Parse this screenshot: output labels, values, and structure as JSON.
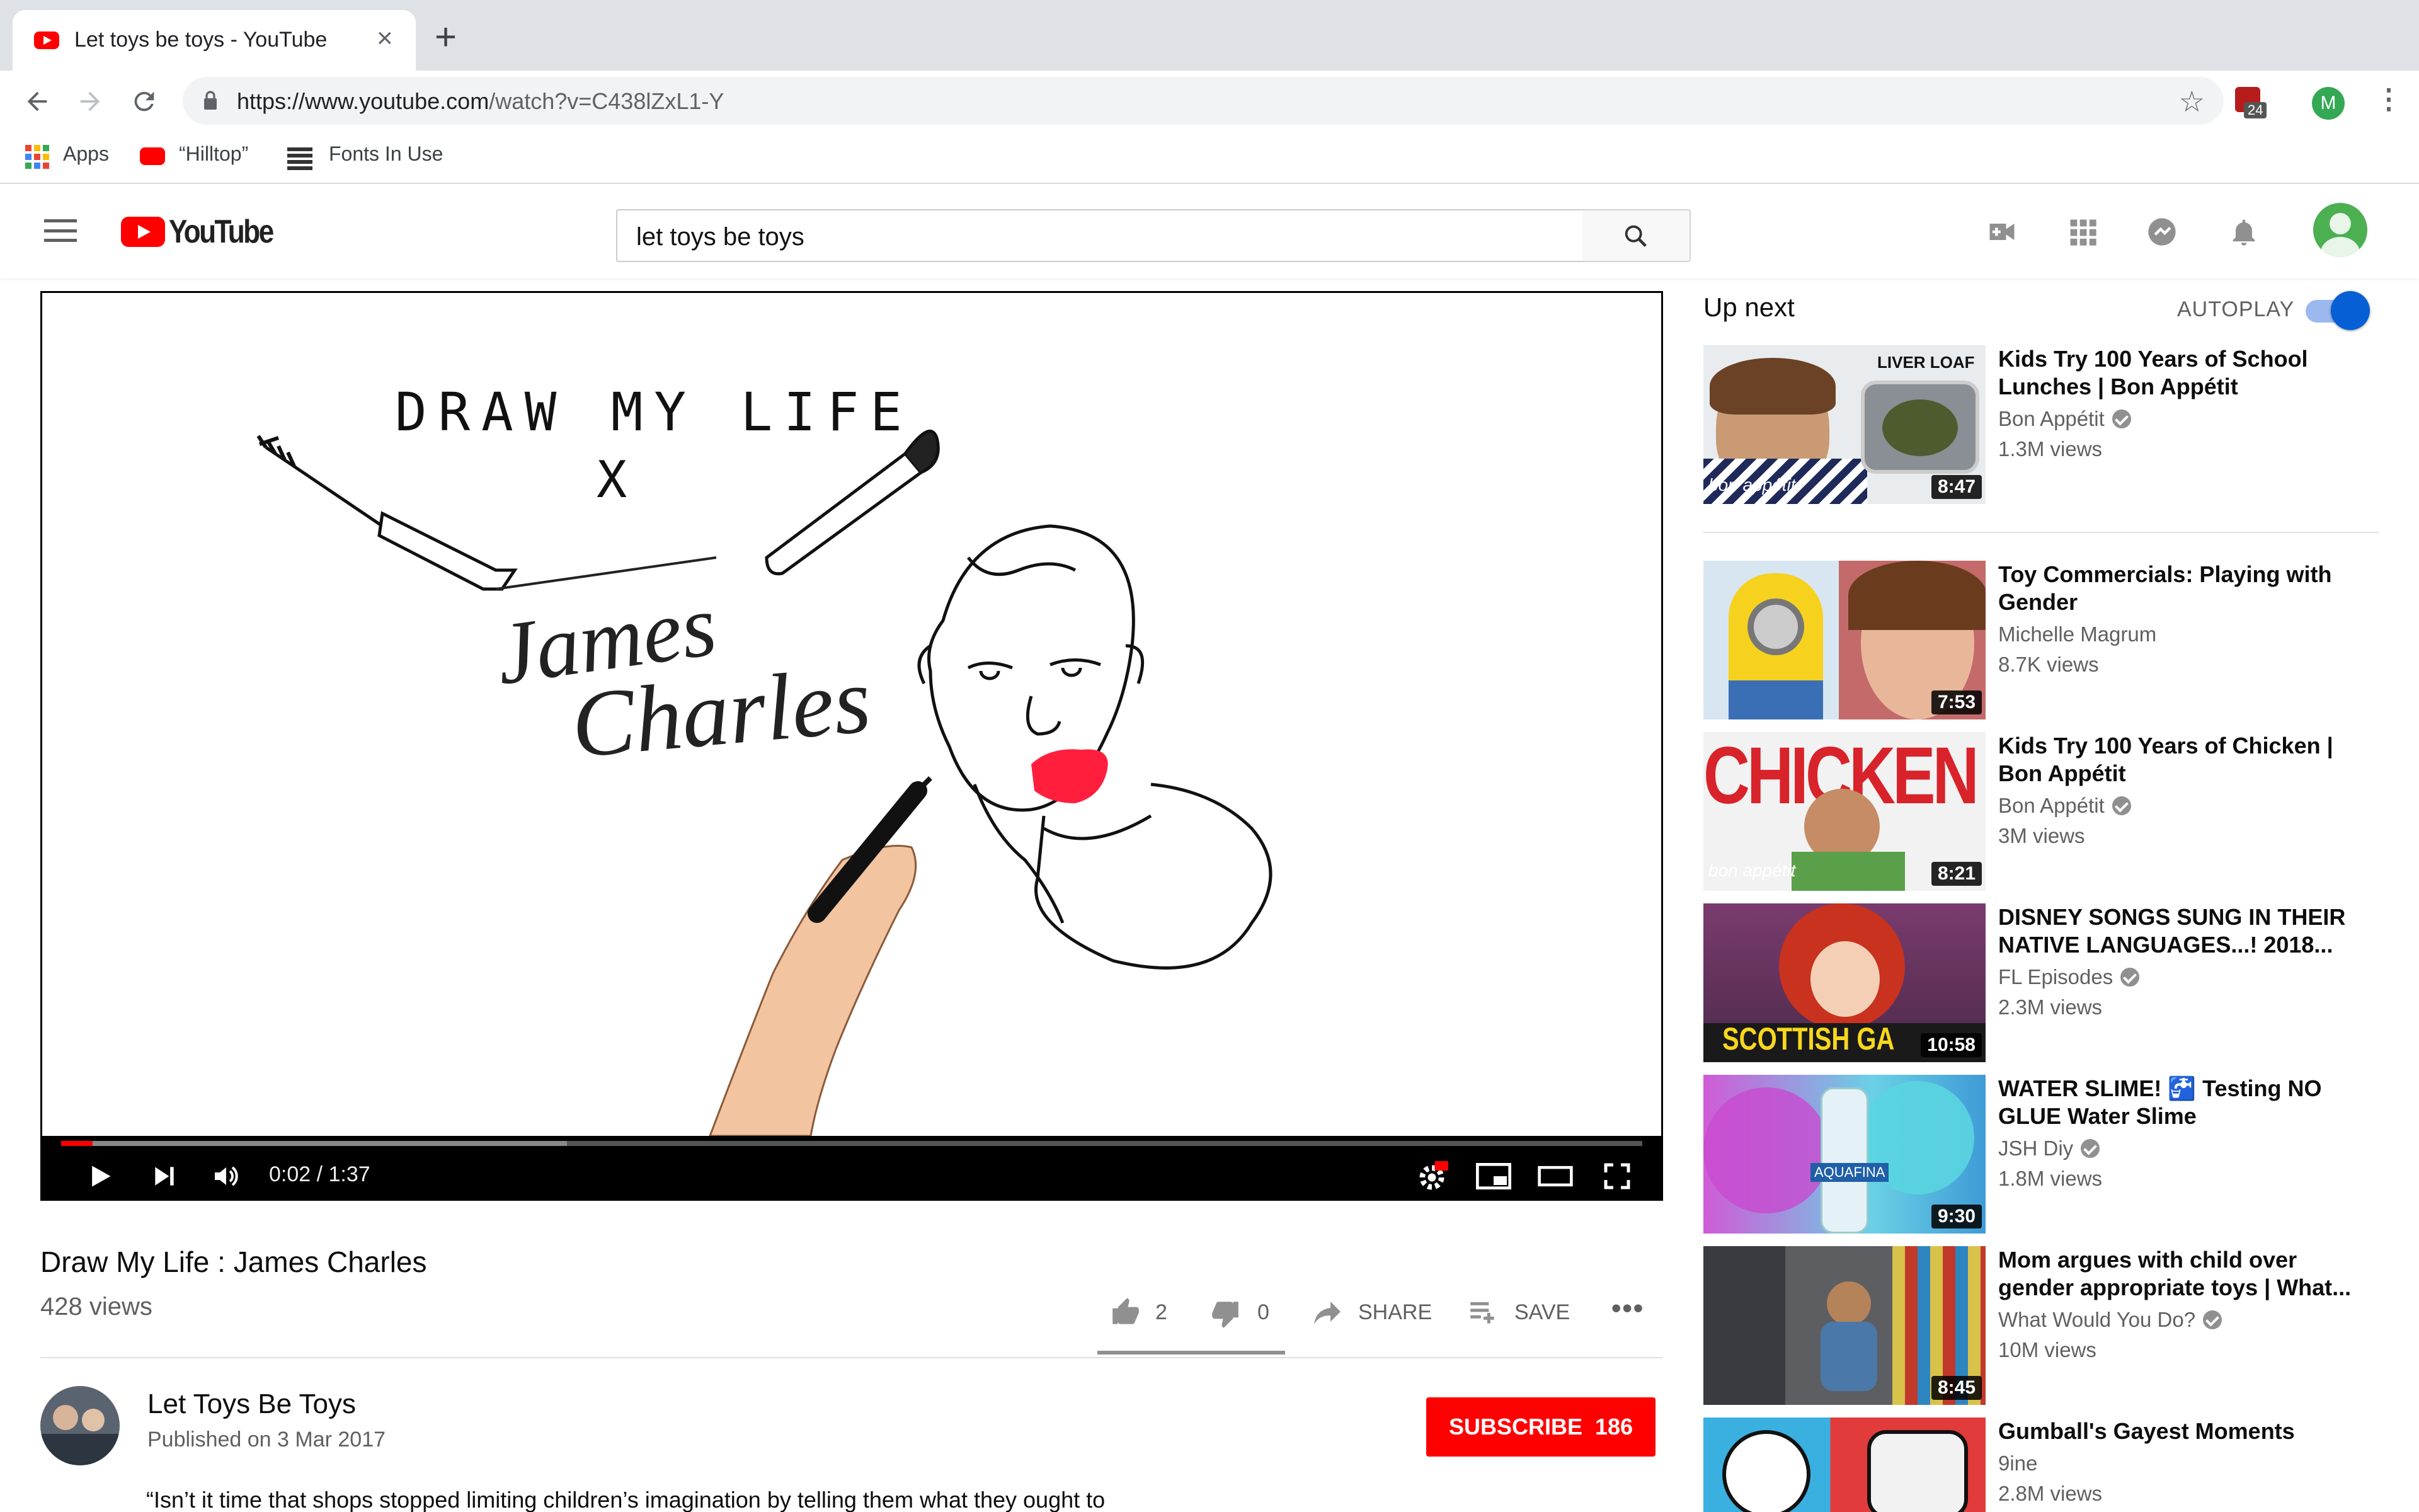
{
  "browser": {
    "tab_title": "Let toys be toys - YouTube",
    "url_host": "https://www.youtube.com",
    "url_path": "/watch?v=C438lZxL1-Y",
    "extension_badge": "24",
    "profile_initial": "M",
    "bookmarks": [
      "Apps",
      "“Hilltop”",
      "Fonts In Use"
    ]
  },
  "masthead": {
    "logo_text": "YouTube",
    "search_query": "let toys be toys"
  },
  "player": {
    "artwork_title": "DRAW MY LIFE",
    "artwork_x": "X",
    "artwork_signature_line1": "James",
    "artwork_signature_line2": "Charles",
    "time_display": "0:02 / 1:37",
    "progress_played": 0.02,
    "progress_buffered": 0.32
  },
  "video": {
    "title": "Draw My Life : James Charles",
    "views": "428 views",
    "likes": "2",
    "dislikes": "0",
    "share_label": "SHARE",
    "save_label": "SAVE"
  },
  "channel": {
    "name": "Let Toys Be Toys",
    "published": "Published on 3 Mar 2017",
    "subscribe_label": "SUBSCRIBE",
    "subscriber_count": "186",
    "description": "“Isn’t it time that shops stopped limiting children’s imagination by telling them what they ought to"
  },
  "sidebar": {
    "up_next_label": "Up next",
    "autoplay_label": "AUTOPLAY",
    "autoplay_on": true,
    "videos": [
      {
        "title": "Kids Try 100 Years of School Lunches | Bon Appétit",
        "channel": "Bon Appétit",
        "verified": true,
        "views": "1.3M views",
        "duration": "8:47",
        "thumb_text": "LIVER LOAF",
        "thumb_caption": "bon appétit"
      },
      {
        "title": "Toy Commercials: Playing with Gender",
        "channel": "Michelle Magrum",
        "verified": false,
        "views": "8.7K views",
        "duration": "7:53"
      },
      {
        "title": "Kids Try 100 Years of Chicken | Bon Appétit",
        "channel": "Bon Appétit",
        "verified": true,
        "views": "3M views",
        "duration": "8:21",
        "thumb_text": "CHICKEN",
        "thumb_caption": "bon appétit"
      },
      {
        "title": "DISNEY SONGS SUNG IN THEIR NATIVE LANGUAGES...! 2018...",
        "channel": "FL Episodes",
        "verified": true,
        "views": "2.3M views",
        "duration": "10:58",
        "thumb_text": "SCOTTISH GA"
      },
      {
        "title": "WATER SLIME! 🚰 Testing NO GLUE Water Slime",
        "channel": "JSH Diy",
        "verified": true,
        "views": "1.8M views",
        "duration": "9:30",
        "thumb_text": "AQUAFINA"
      },
      {
        "title": "Mom argues with child over gender appropriate toys | What...",
        "channel": "What Would You Do?",
        "verified": true,
        "views": "10M views",
        "duration": "8:45"
      },
      {
        "title": "Gumball's Gayest Moments",
        "channel": "9ine",
        "verified": false,
        "views": "2.8M views",
        "duration": ""
      }
    ]
  },
  "colors": {
    "youtube_red": "#ff0000",
    "autoplay_blue": "#065fd4",
    "lipstick_red": "#ff1f3d"
  }
}
